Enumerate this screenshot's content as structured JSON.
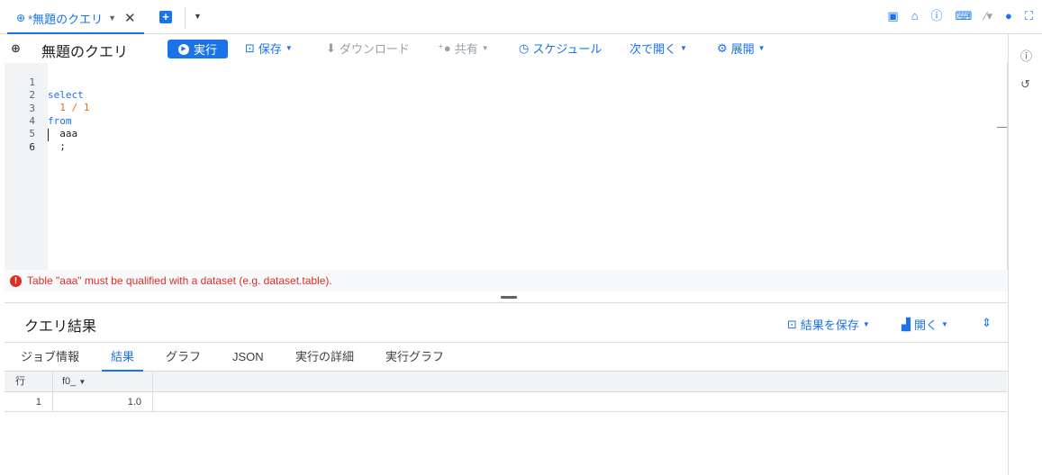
{
  "tab": {
    "label": "*無題のクエリ",
    "close_glyph": "✕"
  },
  "toolbar": {
    "title": "無題のクエリ",
    "run_label": "実行",
    "save_label": "保存",
    "download_label": "ダウンロード",
    "share_label": "共有",
    "schedule_label": "スケジュール",
    "open_in_label": "次で開く",
    "deploy_label": "展開"
  },
  "editor": {
    "line_numbers": [
      "1",
      "2",
      "3",
      "4",
      "5",
      "6"
    ],
    "lines": [
      {
        "kw": "select",
        "num": "",
        "plain": ""
      },
      {
        "kw": "",
        "num": "  1 / 1",
        "plain": ""
      },
      {
        "kw": "from",
        "num": "",
        "plain": ""
      },
      {
        "kw": "",
        "num": "",
        "plain": "  aaa"
      },
      {
        "kw": "",
        "num": "",
        "plain": "  ;"
      },
      {
        "kw": "",
        "num": "",
        "plain": ""
      }
    ]
  },
  "error": {
    "message": "Table \"aaa\" must be qualified with a dataset (e.g. dataset.table)."
  },
  "results": {
    "title": "クエリ結果",
    "save_results_label": "結果を保存",
    "open_label": "開く",
    "tabs": [
      "ジョブ情報",
      "結果",
      "グラフ",
      "JSON",
      "実行の詳細",
      "実行グラフ"
    ],
    "active_tab": "結果",
    "columns": [
      "行",
      "f0_"
    ],
    "rows": [
      {
        "row": "1",
        "f0_": "1.0"
      }
    ]
  },
  "icons": {
    "accent": "#1a73e8",
    "error": "#d93025"
  }
}
